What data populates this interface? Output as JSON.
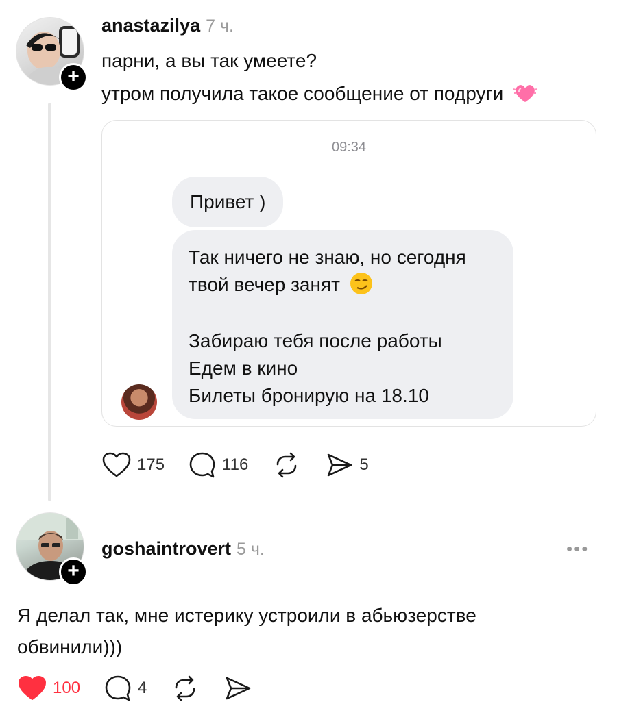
{
  "post": {
    "username": "anastazilya",
    "time": "7 ч.",
    "line1": "парни, а вы так умеете?",
    "line2": "утром получила такое сообщение от подруги",
    "chat": {
      "time": "09:34",
      "bubble1": "Привет )",
      "bubble2_lines": [
        "Так ничего не знаю, но сегодня",
        "твой вечер занят",
        "Забираю тебя после работы",
        "Едем в кино",
        "Билеты бронирую на 18.10"
      ]
    },
    "actions": {
      "likes": "175",
      "comments": "116",
      "shares": "5"
    }
  },
  "reply": {
    "username": "goshaintrovert",
    "time": "5 ч.",
    "text_line1": "Я делал так, мне истерику устроили в абьюзерстве",
    "text_line2": "обвинили)))",
    "actions": {
      "likes": "100",
      "comments": "4"
    }
  },
  "colors": {
    "like_active": "#ff3040",
    "icon": "#1a1a1a"
  }
}
